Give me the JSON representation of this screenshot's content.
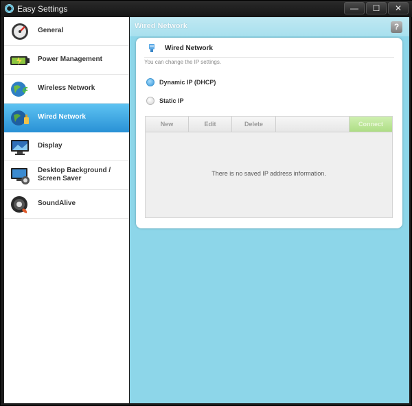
{
  "window": {
    "title": "Easy Settings",
    "minimize_label": "—",
    "maximize_label": "☐",
    "close_label": "✕"
  },
  "sidebar": {
    "items": [
      {
        "label": "General",
        "icon": "general-gauge-icon"
      },
      {
        "label": "Power Management",
        "icon": "battery-icon"
      },
      {
        "label": "Wireless Network",
        "icon": "wireless-globe-icon"
      },
      {
        "label": "Wired Network",
        "icon": "wired-globe-icon",
        "selected": true
      },
      {
        "label": "Display",
        "icon": "display-monitor-icon"
      },
      {
        "label": "Desktop Background / Screen Saver",
        "line1": "Desktop Background /",
        "line2": "Screen Saver",
        "icon": "desktop-background-icon"
      },
      {
        "label": "SoundAlive",
        "icon": "speaker-icon"
      }
    ]
  },
  "content": {
    "header_title": "Wired Network",
    "help_label": "?",
    "panel": {
      "title": "Wired Network",
      "description": "You can change the IP settings.",
      "options": [
        {
          "label": "Dynamic IP (DHCP)",
          "checked": true
        },
        {
          "label": "Static IP",
          "checked": false
        }
      ],
      "toolbar": {
        "new": "New",
        "edit": "Edit",
        "delete": "Delete",
        "connect": "Connect"
      },
      "empty_message": "There is no saved IP address information."
    }
  },
  "colors": {
    "selected_gradient_top": "#5ec3f2",
    "selected_gradient_bottom": "#2a92d6",
    "content_background": "#8dd6e9",
    "connect_button": "#aedd86"
  }
}
